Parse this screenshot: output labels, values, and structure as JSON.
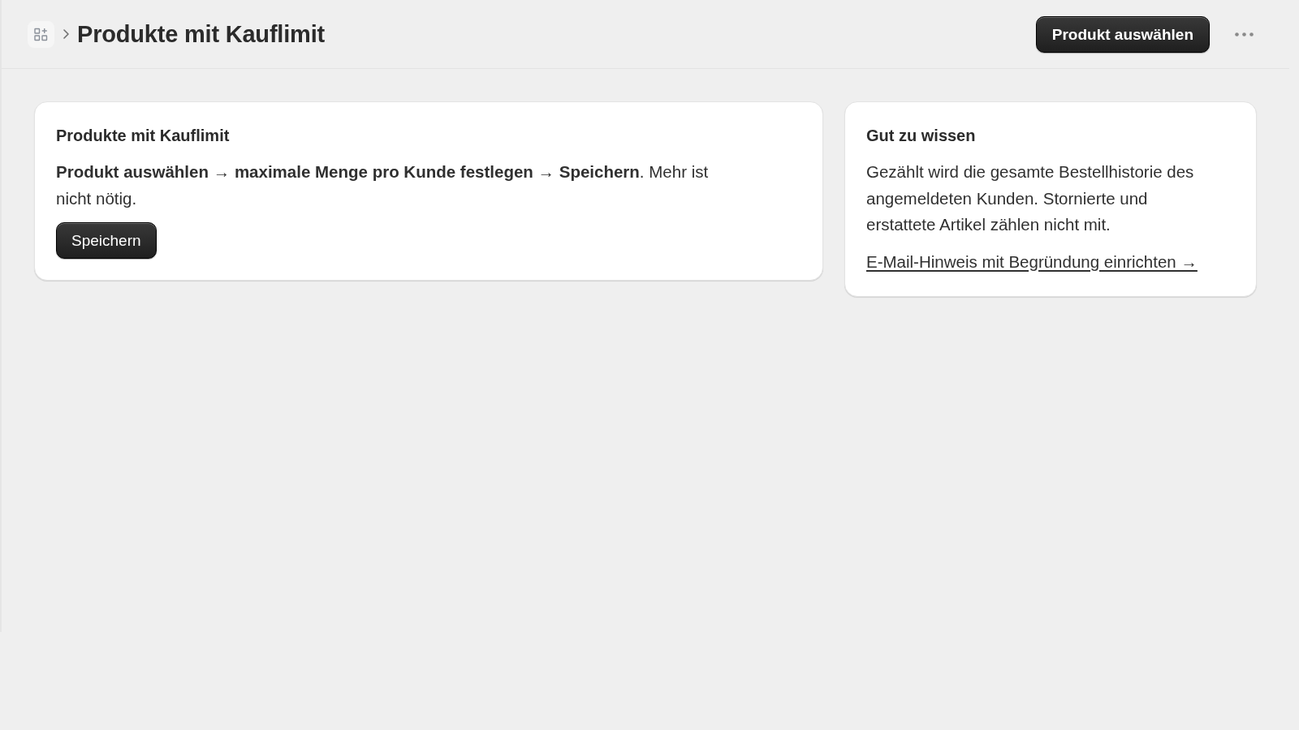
{
  "header": {
    "title": "Produkte mit Kauflimit",
    "primary_button": "Produkt auswählen"
  },
  "cards": [
    {
      "title": "Produkte mit Kauflimit",
      "text": "**Produkt auswählen** → **maximale Menge pro Kunde festlegen** → **Speichern**. Mehr ist nicht nötig.",
      "footer": {
        "kind": "button",
        "label": "Speichern"
      }
    },
    {
      "title": "Gut zu wissen",
      "text": "Gezählt wird die gesamte Bestellhistorie des angemeldeten Kunden. Stornierte und erstattete Artikel zählen nicht mit.",
      "footer": {
        "kind": "link",
        "label": "E-Mail-Hinweis mit Begründung einrichten →"
      }
    }
  ]
}
